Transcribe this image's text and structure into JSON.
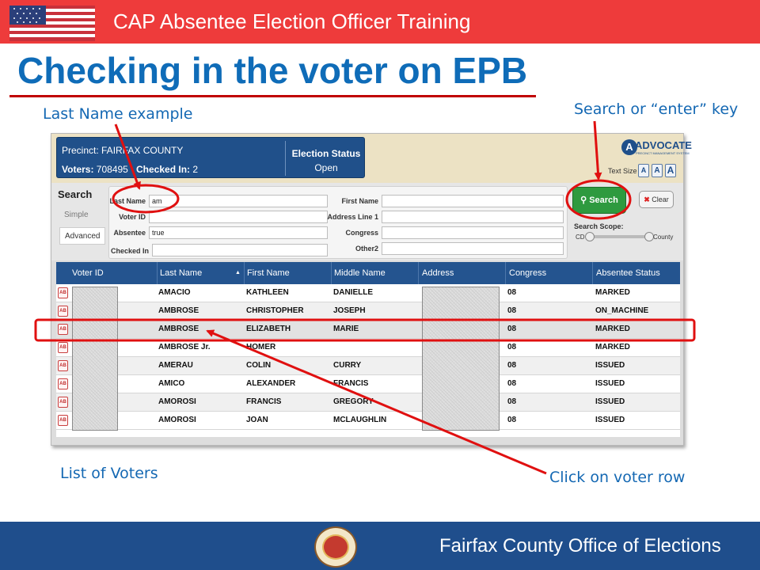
{
  "header": {
    "title": "CAP Absentee Election Officer Training"
  },
  "slide": {
    "title": "Checking in the voter on EPB"
  },
  "callouts": {
    "last_name": "Last Name example",
    "search": "Search or “enter” key",
    "list": "List of Voters",
    "click_row": "Click on voter row"
  },
  "app": {
    "precinct": "Precinct: FAIRFAX COUNTY",
    "voters_label": "Voters:",
    "voters_value": "708495",
    "checked_label": "Checked In:",
    "checked_value": "2",
    "election_status_label": "Election Status",
    "election_status_value": "Open",
    "logo": "ADVOCATE",
    "logo_initial": "A",
    "logo_sub": "PRECINCT MANAGEMENT SYSTEM",
    "text_size_label": "Text Size",
    "text_size_button": "A",
    "search_title": "Search",
    "tab_simple": "Simple",
    "tab_advanced": "Advanced",
    "fields": {
      "last_name_label": "Last Name",
      "last_name_value": "am",
      "voter_id_label": "Voter ID",
      "absentee_label": "Absentee",
      "absentee_value": "true",
      "checked_in_label": "Checked In",
      "first_name_label": "First Name",
      "address1_label": "Address Line 1",
      "congress_label": "Congress",
      "other2_label": "Other2"
    },
    "search_button": "Search",
    "clear_button": "Clear",
    "scope_label": "Search Scope:",
    "scope_cd": "CD",
    "scope_county": "County",
    "columns": [
      "Voter ID",
      "Last Name",
      "First Name",
      "Middle Name",
      "Address",
      "Congress",
      "Absentee Status"
    ],
    "sort_indicator": "▲",
    "ab_badge": "AB",
    "rows": [
      {
        "last": "AMACIO",
        "first": "KATHLEEN",
        "middle": "DANIELLE",
        "congress": "08",
        "status": "MARKED"
      },
      {
        "last": "AMBROSE",
        "first": "CHRISTOPHER",
        "middle": "JOSEPH",
        "congress": "08",
        "status": "ON_MACHINE"
      },
      {
        "last": "AMBROSE",
        "first": "ELIZABETH",
        "middle": "MARIE",
        "congress": "08",
        "status": "MARKED"
      },
      {
        "last": "AMBROSE Jr.",
        "first": "HOMER",
        "middle": "",
        "congress": "08",
        "status": "MARKED"
      },
      {
        "last": "AMERAU",
        "first": "COLIN",
        "middle": "CURRY",
        "congress": "08",
        "status": "ISSUED"
      },
      {
        "last": "AMICO",
        "first": "ALEXANDER",
        "middle": "FRANCIS",
        "congress": "08",
        "status": "ISSUED"
      },
      {
        "last": "AMOROSI",
        "first": "FRANCIS",
        "middle": "GREGORY",
        "congress": "08",
        "status": "ISSUED"
      },
      {
        "last": "AMOROSI",
        "first": "JOAN",
        "middle": "MCLAUGHLIN",
        "congress": "08",
        "status": "ISSUED"
      }
    ]
  },
  "footer": {
    "org": "Fairfax County Office of Elections"
  },
  "colors": {
    "header_red": "#ee3b3b",
    "title_blue": "#0f6cb8",
    "annotation_red": "#e01010",
    "footer_blue": "#1f4e8c",
    "grid_blue": "#24548f"
  }
}
